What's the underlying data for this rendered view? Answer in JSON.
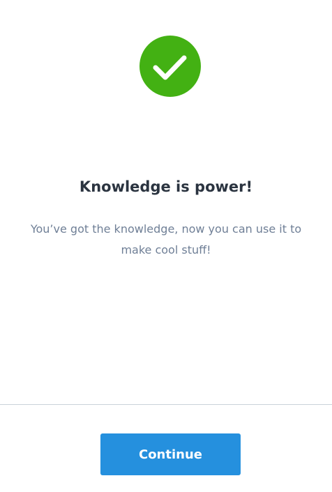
{
  "success": {
    "icon": "checkmark-icon",
    "color": "#43b113"
  },
  "title": "Knowledge is power!",
  "message": "You’ve got the knowledge, now you can use it to make cool stuff!",
  "footer": {
    "continue_label": "Continue",
    "button_color": "#2590de"
  }
}
